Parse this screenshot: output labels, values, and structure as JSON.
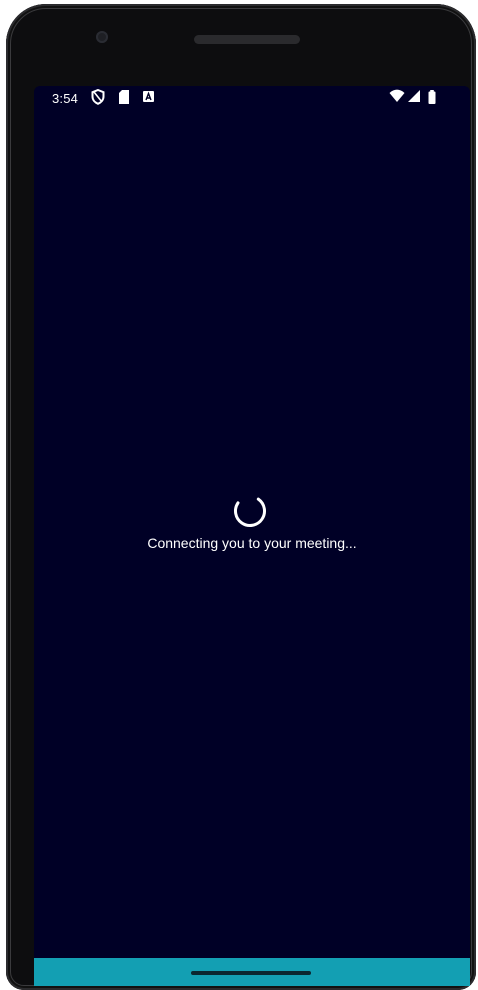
{
  "status_bar": {
    "time": "3:54",
    "left_icons": [
      "vpn-shield-icon",
      "sd-card-icon",
      "notification-a-icon"
    ],
    "right_icons": [
      "wifi-icon",
      "signal-icon",
      "battery-icon"
    ]
  },
  "main": {
    "loading_text": "Connecting you to your meeting..."
  },
  "colors": {
    "screen_background": "#000026",
    "nav_bar": "#139fb3",
    "text": "#ffffff"
  }
}
